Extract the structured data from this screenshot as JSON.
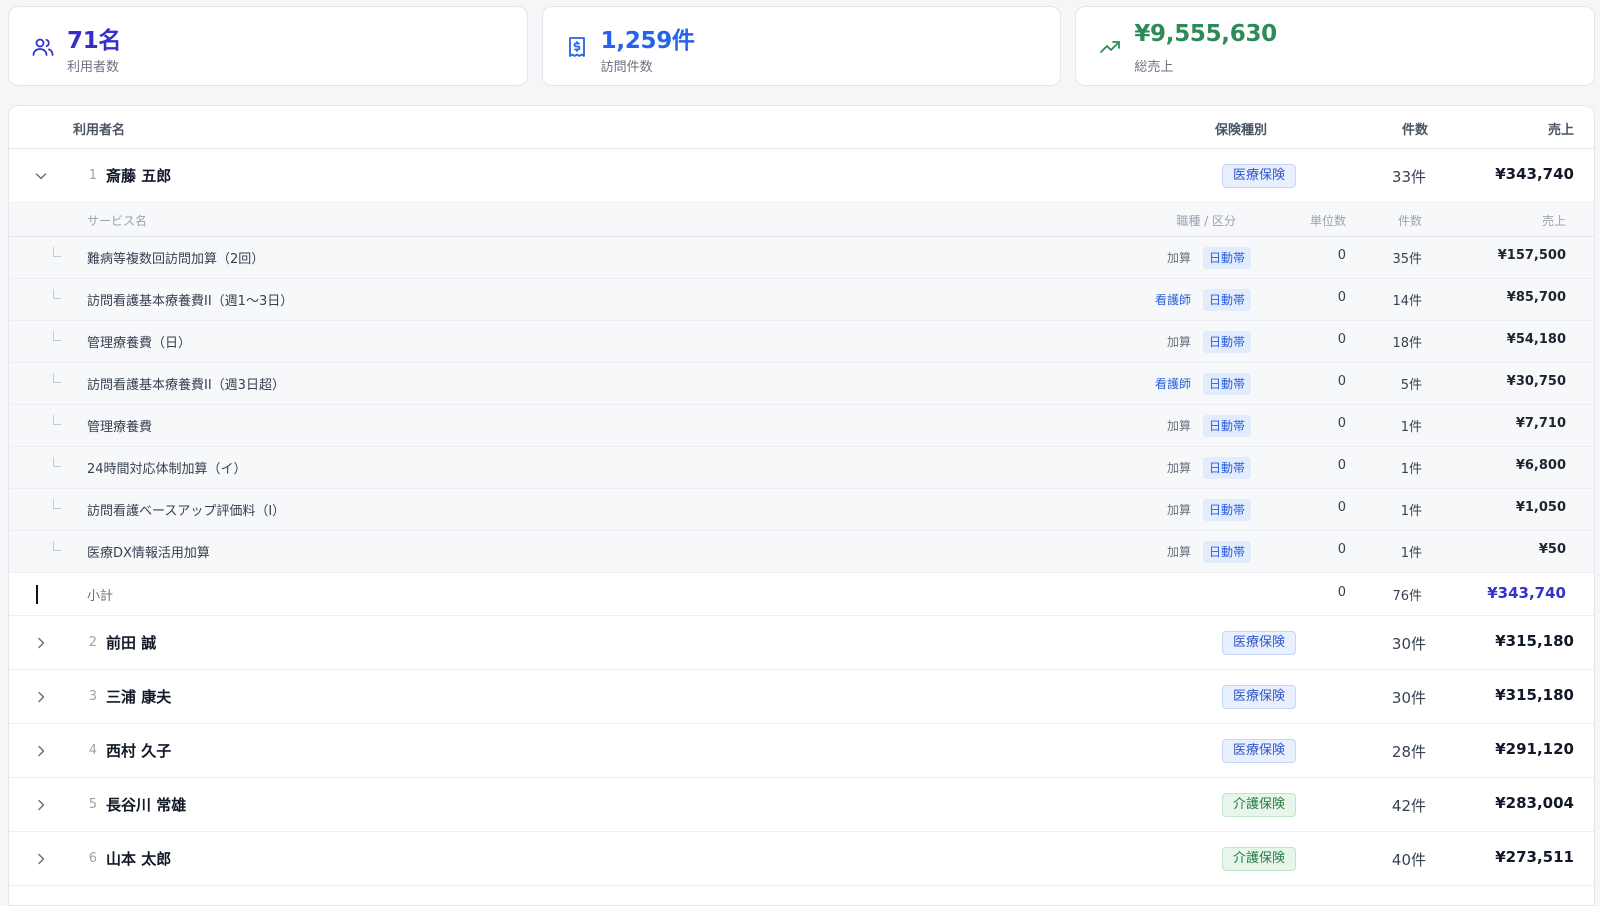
{
  "summary": {
    "users": {
      "value": "71名",
      "label": "利用者数",
      "icon": "users-icon",
      "color": "#3730c8"
    },
    "visits": {
      "value": "1,259件",
      "label": "訪問件数",
      "icon": "receipt-icon",
      "color": "#2563eb"
    },
    "sales": {
      "value": "¥9,555,630",
      "label": "総売上",
      "icon": "trending-up-icon",
      "color": "#2e8b57"
    }
  },
  "table": {
    "headers": {
      "name": "利用者名",
      "insurance": "保険種別",
      "count": "件数",
      "sales": "売上"
    },
    "expanded_user": {
      "index": "1",
      "name": "斎藤 五郎",
      "insurance": "医療保険",
      "count": "33件",
      "sales": "¥343,740",
      "sub_headers": {
        "service": "サービス名",
        "category": "職種 / 区分",
        "units": "単位数",
        "count": "件数",
        "sales": "売上"
      },
      "services": [
        {
          "name": "難病等複数回訪問加算（2回）",
          "tag1": "加算",
          "tag2": "日動帯",
          "units": "0",
          "count": "35件",
          "sales": "¥157,500"
        },
        {
          "name": "訪問看護基本療養費II（週1〜3日）",
          "tag1": "看護師",
          "tag2": "日動帯",
          "units": "0",
          "count": "14件",
          "sales": "¥85,700"
        },
        {
          "name": "管理療養費（日）",
          "tag1": "加算",
          "tag2": "日動帯",
          "units": "0",
          "count": "18件",
          "sales": "¥54,180"
        },
        {
          "name": "訪問看護基本療養費II（週3日超）",
          "tag1": "看護師",
          "tag2": "日動帯",
          "units": "0",
          "count": "5件",
          "sales": "¥30,750"
        },
        {
          "name": "管理療養費",
          "tag1": "加算",
          "tag2": "日動帯",
          "units": "0",
          "count": "1件",
          "sales": "¥7,710"
        },
        {
          "name": "24時間対応体制加算（イ）",
          "tag1": "加算",
          "tag2": "日動帯",
          "units": "0",
          "count": "1件",
          "sales": "¥6,800"
        },
        {
          "name": "訪問看護ベースアップ評価料（I）",
          "tag1": "加算",
          "tag2": "日動帯",
          "units": "0",
          "count": "1件",
          "sales": "¥1,050"
        },
        {
          "name": "医療DX情報活用加算",
          "tag1": "加算",
          "tag2": "日動帯",
          "units": "0",
          "count": "1件",
          "sales": "¥50"
        }
      ],
      "subtotal": {
        "label": "小計",
        "units": "0",
        "count": "76件",
        "sales": "¥343,740"
      }
    },
    "users": [
      {
        "index": "2",
        "name": "前田 誠",
        "insurance": "医療保険",
        "count": "30件",
        "sales": "¥315,180"
      },
      {
        "index": "3",
        "name": "三浦 康夫",
        "insurance": "医療保険",
        "count": "30件",
        "sales": "¥315,180"
      },
      {
        "index": "4",
        "name": "西村 久子",
        "insurance": "医療保険",
        "count": "28件",
        "sales": "¥291,120"
      },
      {
        "index": "5",
        "name": "長谷川 常雄",
        "insurance": "介護保険",
        "count": "42件",
        "sales": "¥283,004"
      },
      {
        "index": "6",
        "name": "山本 太郎",
        "insurance": "介護保険",
        "count": "40件",
        "sales": "¥273,511"
      }
    ]
  }
}
